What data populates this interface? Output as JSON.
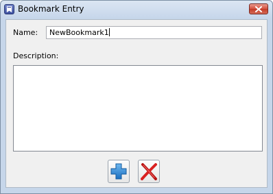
{
  "window": {
    "title": "Bookmark Entry",
    "app_icon": "bookmark-app-icon",
    "close_icon": "close-icon"
  },
  "form": {
    "name_label": "Name:",
    "name_value": "NewBookmark1",
    "description_label": "Description:",
    "description_value": ""
  },
  "buttons": {
    "add_icon": "plus-icon",
    "cancel_icon": "red-x-icon"
  },
  "colors": {
    "title_bar": "#c6d6ea",
    "close_button": "#c8432f",
    "add_icon": "#2a86d4",
    "cancel_icon": "#d01818"
  }
}
